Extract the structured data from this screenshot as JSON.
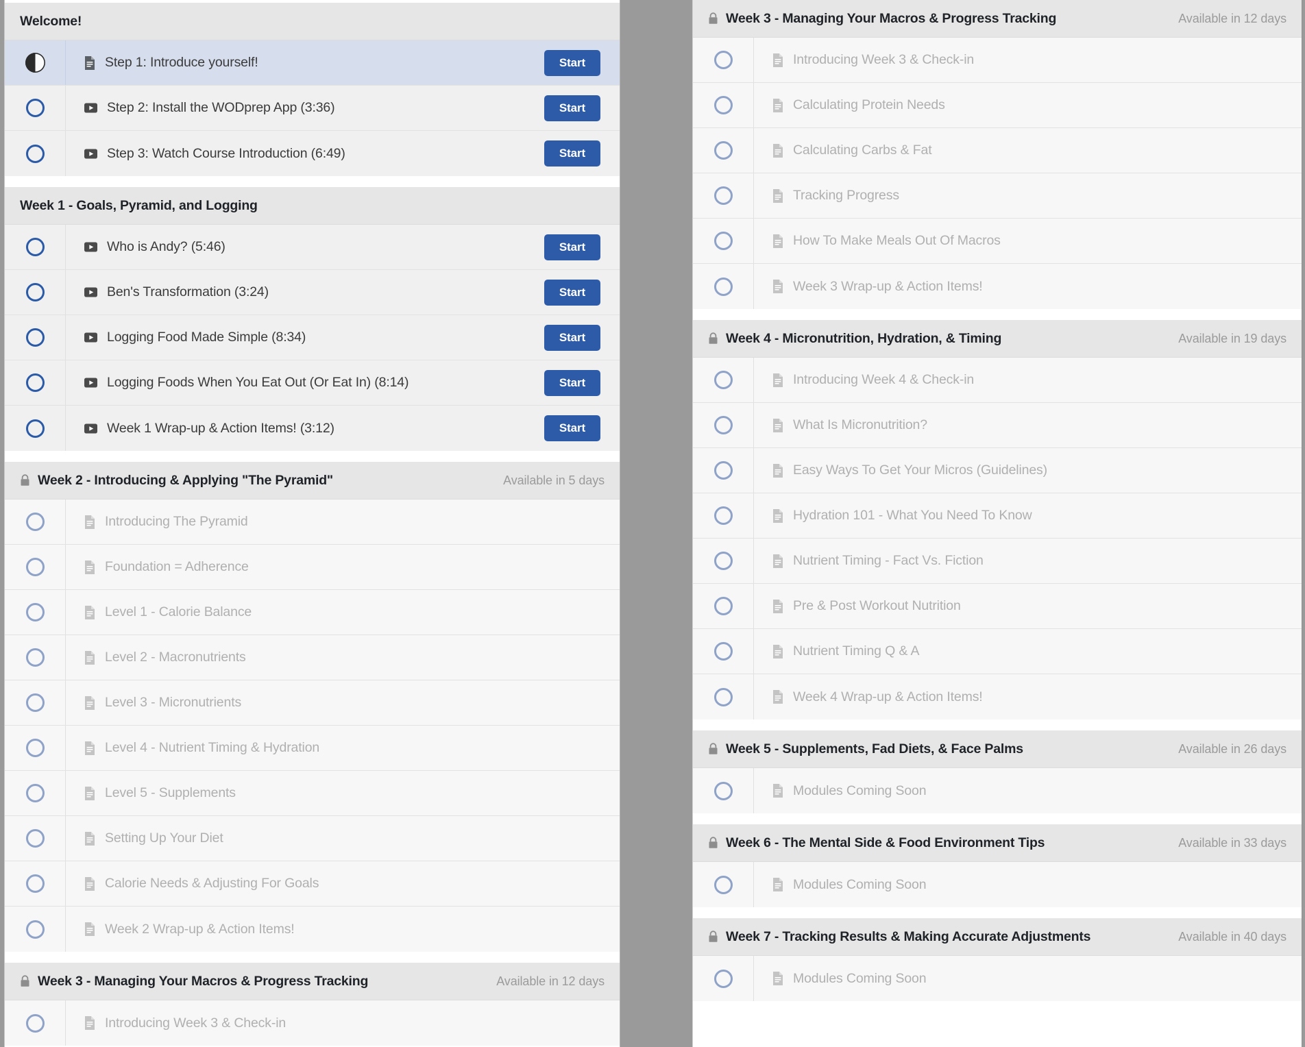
{
  "theme": {
    "accent": "#2d5ba8",
    "active_row_bg": "#d6dded",
    "section_header_bg": "#e6e6e6",
    "row_bg": "#f0f0f0",
    "locked_row_bg": "#f7f7f7",
    "locked_text": "#b0b0b0",
    "circle_unlocked": "#2b5aa7",
    "circle_locked": "#8fa2c7",
    "page_bg": "#9a9a9a"
  },
  "labels": {
    "start_button": "Start",
    "lock_icon": "lock-icon",
    "doc_icon": "document-icon",
    "video_icon": "video-play-icon"
  },
  "left_panel": {
    "sections": [
      {
        "title": "Welcome!",
        "locked": false,
        "availability": "",
        "items": [
          {
            "label": "Step 1: Introduce yourself!",
            "type": "doc",
            "state": "in-progress",
            "locked": false,
            "action": "Start"
          },
          {
            "label": "Step 2: Install the WODprep App (3:36)",
            "type": "video",
            "state": "not-started",
            "locked": false,
            "action": "Start"
          },
          {
            "label": "Step 3: Watch Course Introduction (6:49)",
            "type": "video",
            "state": "not-started",
            "locked": false,
            "action": "Start"
          }
        ]
      },
      {
        "title": "Week 1 - Goals, Pyramid, and Logging",
        "locked": false,
        "availability": "",
        "items": [
          {
            "label": "Who is Andy? (5:46)",
            "type": "video",
            "state": "not-started",
            "locked": false,
            "action": "Start"
          },
          {
            "label": "Ben's Transformation (3:24)",
            "type": "video",
            "state": "not-started",
            "locked": false,
            "action": "Start"
          },
          {
            "label": "Logging Food Made Simple (8:34)",
            "type": "video",
            "state": "not-started",
            "locked": false,
            "action": "Start"
          },
          {
            "label": "Logging Foods When You Eat Out (Or Eat In) (8:14)",
            "type": "video",
            "state": "not-started",
            "locked": false,
            "action": "Start"
          },
          {
            "label": "Week 1 Wrap-up & Action Items! (3:12)",
            "type": "video",
            "state": "not-started",
            "locked": false,
            "action": "Start"
          }
        ]
      },
      {
        "title": "Week 2 - Introducing & Applying \"The Pyramid\"",
        "locked": true,
        "availability": "Available in 5 days",
        "items": [
          {
            "label": "Introducing The Pyramid",
            "type": "doc",
            "state": "not-started",
            "locked": true,
            "action": ""
          },
          {
            "label": "Foundation = Adherence",
            "type": "doc",
            "state": "not-started",
            "locked": true,
            "action": ""
          },
          {
            "label": "Level 1 - Calorie Balance",
            "type": "doc",
            "state": "not-started",
            "locked": true,
            "action": ""
          },
          {
            "label": "Level 2 - Macronutrients",
            "type": "doc",
            "state": "not-started",
            "locked": true,
            "action": ""
          },
          {
            "label": "Level 3 - Micronutrients",
            "type": "doc",
            "state": "not-started",
            "locked": true,
            "action": ""
          },
          {
            "label": "Level 4 - Nutrient Timing & Hydration",
            "type": "doc",
            "state": "not-started",
            "locked": true,
            "action": ""
          },
          {
            "label": "Level 5 - Supplements",
            "type": "doc",
            "state": "not-started",
            "locked": true,
            "action": ""
          },
          {
            "label": "Setting Up Your Diet",
            "type": "doc",
            "state": "not-started",
            "locked": true,
            "action": ""
          },
          {
            "label": "Calorie Needs & Adjusting For Goals",
            "type": "doc",
            "state": "not-started",
            "locked": true,
            "action": ""
          },
          {
            "label": "Week 2 Wrap-up & Action Items!",
            "type": "doc",
            "state": "not-started",
            "locked": true,
            "action": ""
          }
        ]
      },
      {
        "title": "Week 3 - Managing Your Macros & Progress Tracking",
        "locked": true,
        "availability": "Available in 12 days",
        "items": [
          {
            "label": "Introducing Week 3 & Check-in",
            "type": "doc",
            "state": "not-started",
            "locked": true,
            "action": ""
          }
        ]
      }
    ]
  },
  "right_panel": {
    "sections": [
      {
        "title": "Week 3 - Managing Your Macros & Progress Tracking",
        "locked": true,
        "availability": "Available in 12 days",
        "items": [
          {
            "label": "Introducing Week 3 & Check-in",
            "type": "doc",
            "state": "not-started",
            "locked": true,
            "action": ""
          },
          {
            "label": "Calculating Protein Needs",
            "type": "doc",
            "state": "not-started",
            "locked": true,
            "action": ""
          },
          {
            "label": "Calculating Carbs & Fat",
            "type": "doc",
            "state": "not-started",
            "locked": true,
            "action": ""
          },
          {
            "label": "Tracking Progress",
            "type": "doc",
            "state": "not-started",
            "locked": true,
            "action": ""
          },
          {
            "label": "How To Make Meals Out Of Macros",
            "type": "doc",
            "state": "not-started",
            "locked": true,
            "action": ""
          },
          {
            "label": "Week 3 Wrap-up & Action Items!",
            "type": "doc",
            "state": "not-started",
            "locked": true,
            "action": ""
          }
        ]
      },
      {
        "title": "Week 4 - Micronutrition, Hydration, & Timing",
        "locked": true,
        "availability": "Available in 19 days",
        "items": [
          {
            "label": "Introducing Week 4 & Check-in",
            "type": "doc",
            "state": "not-started",
            "locked": true,
            "action": ""
          },
          {
            "label": "What Is Micronutrition?",
            "type": "doc",
            "state": "not-started",
            "locked": true,
            "action": ""
          },
          {
            "label": "Easy Ways To Get Your Micros (Guidelines)",
            "type": "doc",
            "state": "not-started",
            "locked": true,
            "action": ""
          },
          {
            "label": "Hydration 101 - What You Need To Know",
            "type": "doc",
            "state": "not-started",
            "locked": true,
            "action": ""
          },
          {
            "label": "Nutrient Timing - Fact Vs. Fiction",
            "type": "doc",
            "state": "not-started",
            "locked": true,
            "action": ""
          },
          {
            "label": "Pre & Post Workout Nutrition",
            "type": "doc",
            "state": "not-started",
            "locked": true,
            "action": ""
          },
          {
            "label": "Nutrient Timing Q & A",
            "type": "doc",
            "state": "not-started",
            "locked": true,
            "action": ""
          },
          {
            "label": "Week 4 Wrap-up & Action Items!",
            "type": "doc",
            "state": "not-started",
            "locked": true,
            "action": ""
          }
        ]
      },
      {
        "title": "Week 5 - Supplements, Fad Diets, & Face Palms",
        "locked": true,
        "availability": "Available in 26 days",
        "items": [
          {
            "label": "Modules Coming Soon",
            "type": "doc",
            "state": "not-started",
            "locked": true,
            "action": ""
          }
        ]
      },
      {
        "title": "Week 6 - The Mental Side & Food Environment Tips",
        "locked": true,
        "availability": "Available in 33 days",
        "items": [
          {
            "label": "Modules Coming Soon",
            "type": "doc",
            "state": "not-started",
            "locked": true,
            "action": ""
          }
        ]
      },
      {
        "title": "Week 7 - Tracking Results & Making Accurate Adjustments",
        "locked": true,
        "availability": "Available in 40 days",
        "items": [
          {
            "label": "Modules Coming Soon",
            "type": "doc",
            "state": "not-started",
            "locked": true,
            "action": ""
          }
        ]
      }
    ]
  }
}
